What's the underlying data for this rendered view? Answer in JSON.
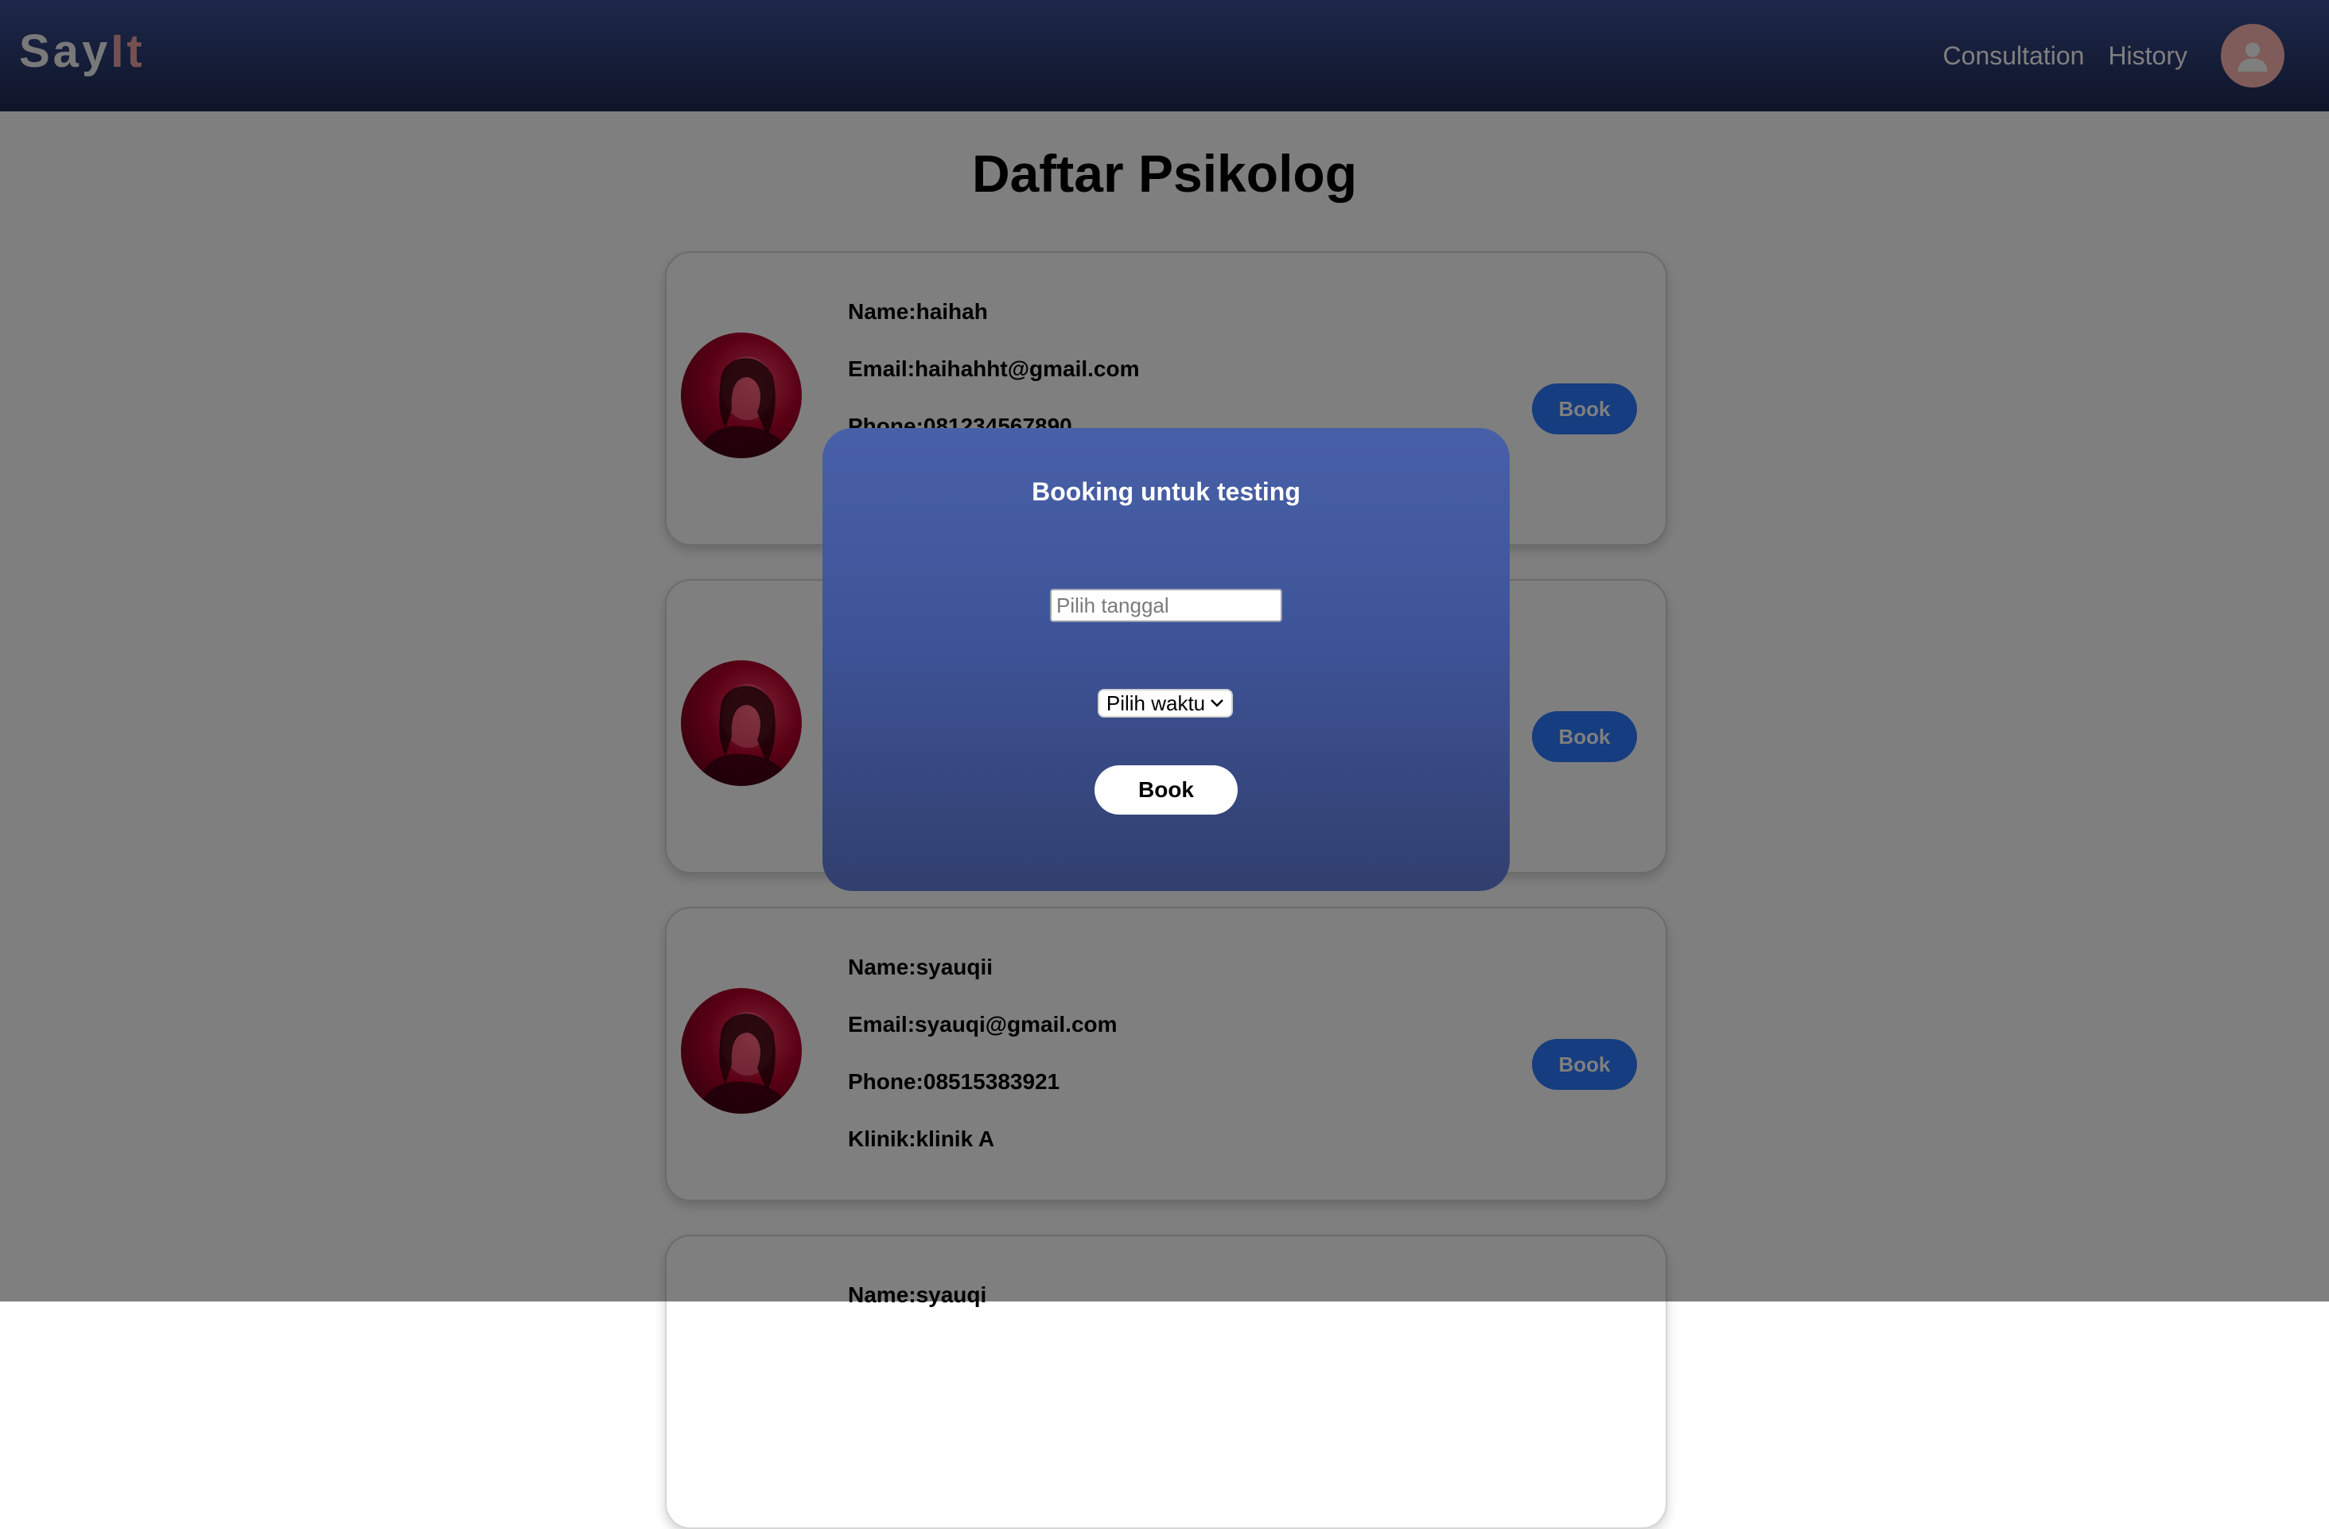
{
  "navbar": {
    "brand_say": "Say",
    "brand_it": "It",
    "links": [
      "Consultation",
      "History"
    ],
    "avatar_icon": "user-icon"
  },
  "main": {
    "title": "Daftar Psikolog",
    "cards": [
      {
        "name": "Name:haihah",
        "email": "Email:haihahht@gmail.com",
        "phone": "Phone:081234567890",
        "clinic": "",
        "book_label": "Book"
      },
      {
        "name": "",
        "email": "",
        "phone": "",
        "clinic": "",
        "book_label": "Book"
      },
      {
        "name": "Name:syauqii",
        "email": "Email:syauqi@gmail.com",
        "phone": "Phone:08515383921",
        "clinic": "Klinik:klinik A",
        "book_label": "Book"
      },
      {
        "name": "Name:syauqi",
        "email": "",
        "phone": "",
        "clinic": "",
        "book_label": ""
      }
    ]
  },
  "modal": {
    "title": "Booking untuk testing",
    "date_placeholder": "Pilih tanggal",
    "time_select_value": "Pilih waktu",
    "book_label": "Book"
  },
  "colors": {
    "navbar": "#2a3a70",
    "accent_button": "#2b7bff",
    "modal_top": "#4860a8",
    "modal_bottom": "#313f6e",
    "brand_it": "#e8a3a0",
    "avatar": "#ffb8b3"
  }
}
